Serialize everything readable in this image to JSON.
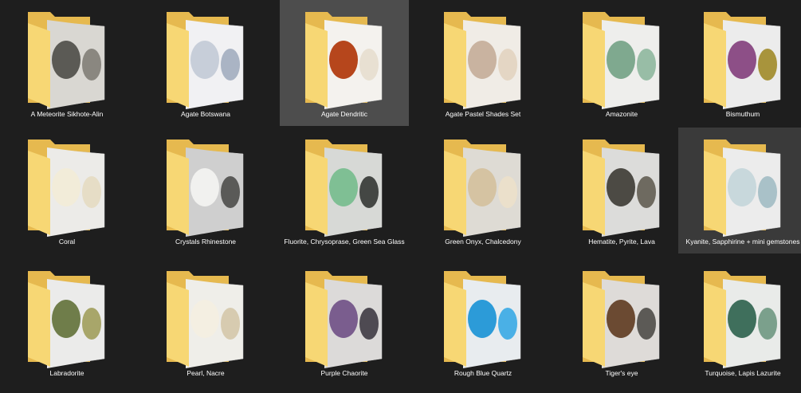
{
  "view": "large-icons",
  "selected_item": "Agate Dendritic",
  "items": [
    {
      "name": "A Meteorite Sikhote-Alin",
      "thumb": {
        "bg": "#d9d7d2",
        "stones": [
          {
            "c": "#5b5a55"
          },
          {
            "c": "#8a8780"
          }
        ]
      }
    },
    {
      "name": "Agate Botswana",
      "thumb": {
        "bg": "#f1f1f3",
        "stones": [
          {
            "c": "#c7ced9"
          },
          {
            "c": "#aab4c4"
          }
        ]
      }
    },
    {
      "name": "Agate Dendritic",
      "thumb": {
        "bg": "#f4f2ee",
        "stones": [
          {
            "c": "#b6461c"
          },
          {
            "c": "#e8e0d2"
          }
        ]
      }
    },
    {
      "name": "Agate Pastel Shades Set",
      "thumb": {
        "bg": "#f0ece6",
        "stones": [
          {
            "c": "#c9b3a0"
          },
          {
            "c": "#e4d6c4"
          }
        ]
      }
    },
    {
      "name": "Amazonite",
      "thumb": {
        "bg": "#eeeeec",
        "stones": [
          {
            "c": "#7fa98f"
          },
          {
            "c": "#98bda6"
          }
        ]
      }
    },
    {
      "name": "Bismuthum",
      "thumb": {
        "bg": "#ececec",
        "stones": [
          {
            "c": "#8d4f87"
          },
          {
            "c": "#a8943c"
          }
        ]
      }
    },
    {
      "name": "Coral",
      "thumb": {
        "bg": "#ecebe8",
        "stones": [
          {
            "c": "#f2ecd9"
          },
          {
            "c": "#e6ddc6"
          }
        ]
      }
    },
    {
      "name": "Crystals Rhinestone",
      "thumb": {
        "bg": "#cfcfcf",
        "stones": [
          {
            "c": "#f1f1ef"
          },
          {
            "c": "#5a5a58"
          }
        ]
      }
    },
    {
      "name": "Fluorite, Chrysoprase, Green Sea Glass",
      "thumb": {
        "bg": "#d7d9d6",
        "stones": [
          {
            "c": "#7fbf94"
          },
          {
            "c": "#444744"
          }
        ]
      }
    },
    {
      "name": "Green Onyx, Chalcedony",
      "thumb": {
        "bg": "#dedbd4",
        "stones": [
          {
            "c": "#d5c3a2"
          },
          {
            "c": "#ebe0cb"
          }
        ]
      }
    },
    {
      "name": "Hematite, Pyrite, Lava",
      "thumb": {
        "bg": "#dcdcda",
        "stones": [
          {
            "c": "#4c4a44"
          },
          {
            "c": "#6e6a60"
          }
        ]
      }
    },
    {
      "name": "Kyanite, Sapphirine + mini gemstones",
      "thumb": {
        "bg": "#ececec",
        "stones": [
          {
            "c": "#c8d8dc"
          },
          {
            "c": "#a9c1c8"
          }
        ]
      }
    },
    {
      "name": "Labradorite",
      "thumb": {
        "bg": "#ebebea",
        "stones": [
          {
            "c": "#6f7d4a"
          },
          {
            "c": "#a8a66a"
          }
        ]
      }
    },
    {
      "name": "Pearl, Nacre",
      "thumb": {
        "bg": "#efeee9",
        "stones": [
          {
            "c": "#f4efe2"
          },
          {
            "c": "#d7cbb0"
          }
        ]
      }
    },
    {
      "name": "Purple Chaorite",
      "thumb": {
        "bg": "#dcdad9",
        "stones": [
          {
            "c": "#7a5d8e"
          },
          {
            "c": "#4e4a52"
          }
        ]
      }
    },
    {
      "name": "Rough Blue Quartz",
      "thumb": {
        "bg": "#e8ecef",
        "stones": [
          {
            "c": "#2c9bd8"
          },
          {
            "c": "#4ab0e6"
          }
        ]
      }
    },
    {
      "name": "Tiger's eye",
      "thumb": {
        "bg": "#dedbd8",
        "stones": [
          {
            "c": "#6b4a32"
          },
          {
            "c": "#5c5a56"
          }
        ]
      }
    },
    {
      "name": "Turquoise, Lapis Lazurite",
      "thumb": {
        "bg": "#e9ebe9",
        "stones": [
          {
            "c": "#3f6f5c"
          },
          {
            "c": "#7ba08c"
          }
        ]
      }
    }
  ],
  "colors": {
    "background": "#1e1e1e",
    "folder_back": "#e6b94f",
    "folder_front": "#f7d774",
    "selected": "#4d4d4d",
    "hover": "#3a3a3a",
    "text": "#ffffff"
  }
}
